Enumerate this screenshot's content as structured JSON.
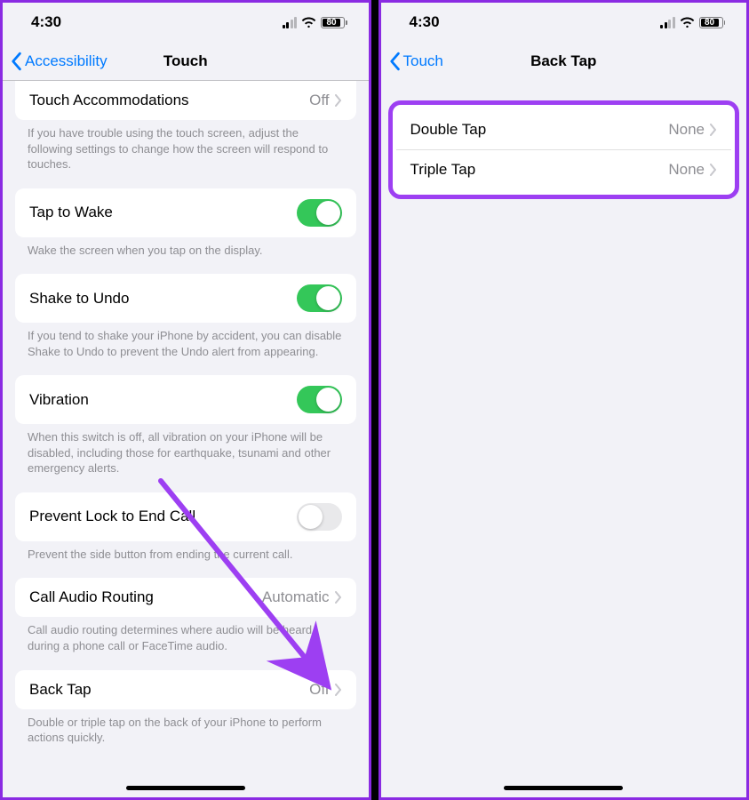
{
  "left": {
    "status": {
      "time": "4:30",
      "battery": "80"
    },
    "nav": {
      "back": "Accessibility",
      "title": "Touch"
    },
    "groups": [
      {
        "row": {
          "label": "Touch Accommodations",
          "value": "Off"
        },
        "footer": "If you have trouble using the touch screen, adjust the following settings to change how the screen will respond to touches."
      },
      {
        "row": {
          "label": "Tap to Wake",
          "toggle": true
        },
        "footer": "Wake the screen when you tap on the display."
      },
      {
        "row": {
          "label": "Shake to Undo",
          "toggle": true
        },
        "footer": "If you tend to shake your iPhone by accident, you can disable Shake to Undo to prevent the Undo alert from appearing."
      },
      {
        "row": {
          "label": "Vibration",
          "toggle": true
        },
        "footer": "When this switch is off, all vibration on your iPhone will be disabled, including those for earthquake, tsunami and other emergency alerts."
      },
      {
        "row": {
          "label": "Prevent Lock to End Call",
          "toggle": false
        },
        "footer": "Prevent the side button from ending the current call."
      },
      {
        "row": {
          "label": "Call Audio Routing",
          "value": "Automatic"
        },
        "footer": "Call audio routing determines where audio will be heard during a phone call or FaceTime audio."
      },
      {
        "row": {
          "label": "Back Tap",
          "value": "Off"
        },
        "footer": "Double or triple tap on the back of your iPhone to perform actions quickly."
      }
    ]
  },
  "right": {
    "status": {
      "time": "4:30",
      "battery": "80"
    },
    "nav": {
      "back": "Touch",
      "title": "Back Tap"
    },
    "rows": [
      {
        "label": "Double Tap",
        "value": "None"
      },
      {
        "label": "Triple Tap",
        "value": "None"
      }
    ]
  }
}
